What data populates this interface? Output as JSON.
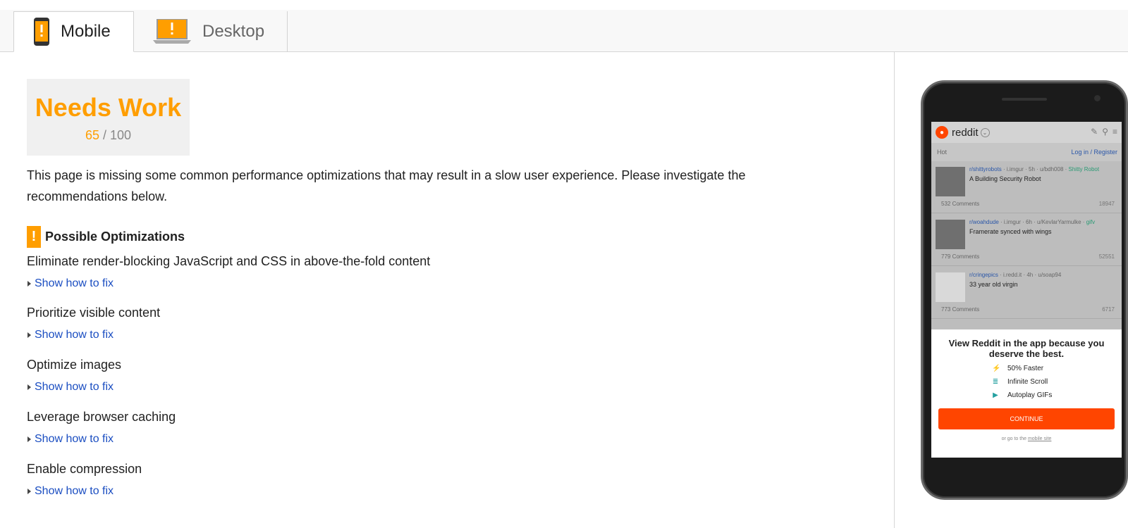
{
  "tabs": [
    {
      "label": "Mobile",
      "active": true,
      "icon": "mobile-phone-icon"
    },
    {
      "label": "Desktop",
      "active": false,
      "icon": "laptop-icon"
    }
  ],
  "score": {
    "verdict": "Needs Work",
    "value": "65",
    "separator": "/",
    "max": "100",
    "color": "#ff9e00"
  },
  "description": "This page is missing some common performance optimizations that may result in a slow user experience. Please investigate the recommendations below.",
  "section": {
    "title": "Possible Optimizations",
    "icon": "warning-icon",
    "icon_text": "!"
  },
  "optimizations": [
    {
      "title": "Eliminate render-blocking JavaScript and CSS in above-the-fold content",
      "link": "Show how to fix"
    },
    {
      "title": "Prioritize visible content",
      "link": "Show how to fix"
    },
    {
      "title": "Optimize images",
      "link": "Show how to fix"
    },
    {
      "title": "Leverage browser caching",
      "link": "Show how to fix"
    },
    {
      "title": "Enable compression",
      "link": "Show how to fix"
    }
  ],
  "preview": {
    "app_name": "reddit",
    "sort": "Hot",
    "login": "Log in / Register",
    "posts": [
      {
        "subreddit": "r/shittyrobots",
        "meta": " · i.imgur · 5h · u/bdh008 · ",
        "flair": "Shitty Robot",
        "title": "A Building Security Robot",
        "comments": "532 Comments",
        "votes": "18947"
      },
      {
        "subreddit": "r/woahdude",
        "meta": " · i.imgur · 6h · u/KevlarYarmulke · ",
        "flair": "gifv",
        "title": "Framerate synced with wings",
        "comments": "779 Comments",
        "votes": "52551"
      },
      {
        "subreddit": "r/cringepics",
        "meta": " · i.redd.it · 4h · u/soap94",
        "flair": "",
        "title": "33 year old virgin",
        "comments": "773 Comments",
        "votes": "6717"
      }
    ],
    "promo_heading": "View Reddit in the app because you deserve the best.",
    "features": [
      "50% Faster",
      "Infinite Scroll",
      "Autoplay GIFs"
    ],
    "continue_label": "CONTINUE",
    "goto_prefix": "or go to the",
    "goto_link": "mobile site",
    "accent": "#ff4500"
  }
}
